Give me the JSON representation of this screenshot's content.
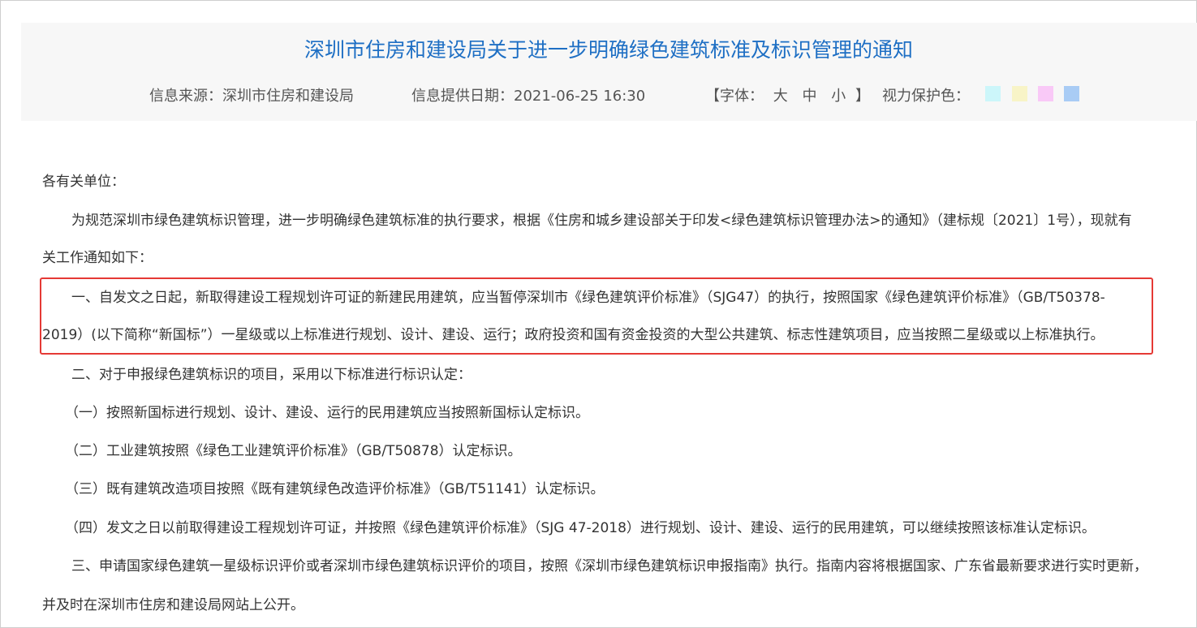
{
  "header": {
    "title": "深圳市住房和建设局关于进一步明确绿色建筑标准及标识管理的通知",
    "source_label": "信息来源：深圳市住房和建设局",
    "date_label": "信息提供日期：2021-06-25 16:30",
    "font_label_open": "【字体：",
    "font_sizes": [
      "大",
      "中",
      "小"
    ],
    "font_label_close": "】",
    "eye_protect_label": "视力保护色：",
    "swatches": [
      "#ccf6fa",
      "#f8f4c7",
      "#f9c9f7",
      "#a9ccf5"
    ]
  },
  "body": {
    "salutation": "各有关单位：",
    "intro_line1": "为规范深圳市绿色建筑标识管理，进一步明确绿色建筑标准的执行要求，根据《住房和城乡建设部关于印发<绿色建筑标识管理办法>的通知》（建标规〔2021〕1号），现就有",
    "intro_line2": "关工作通知如下：",
    "item1_line1": "一、自发文之日起，新取得建设工程规划许可证的新建民用建筑，应当暂停深圳市《绿色建筑评价标准》（SJG47）的执行，按照国家《绿色建筑评价标准》（GB/T50378-",
    "item1_line2": "2019）(以下简称“新国标”）一星级或以上标准进行规划、设计、建设、运行；政府投资和国有资金投资的大型公共建筑、标志性建筑项目，应当按照二星级或以上标准执行。",
    "item2": "二、对于申报绿色建筑标识的项目，采用以下标准进行标识认定：",
    "item2_1": "（一）按照新国标进行规划、设计、建设、运行的民用建筑应当按照新国标认定标识。",
    "item2_2": "（二）工业建筑按照《绿色工业建筑评价标准》（GB/T50878）认定标识。",
    "item2_3": "（三）既有建筑改造项目按照《既有建筑绿色改造评价标准》（GB/T51141）认定标识。",
    "item2_4": "（四）发文之日以前取得建设工程规划许可证，并按照《绿色建筑评价标准》（SJG 47-2018）进行规划、设计、建设、运行的民用建筑，可以继续按照该标准认定标识。",
    "item3_line1": "三、申请国家绿色建筑一星级标识评价或者深圳市绿色建筑标识评价的项目，按照《深圳市绿色建筑标识申报指南》执行。指南内容将根据国家、广东省最新要求进行实时更新，",
    "item3_line2": "并及时在深圳市住房和建设局网站上公开。"
  },
  "colors": {
    "title": "#1e6fc4",
    "highlight_border": "#e53935",
    "header_bg": "#f7f7f7"
  }
}
